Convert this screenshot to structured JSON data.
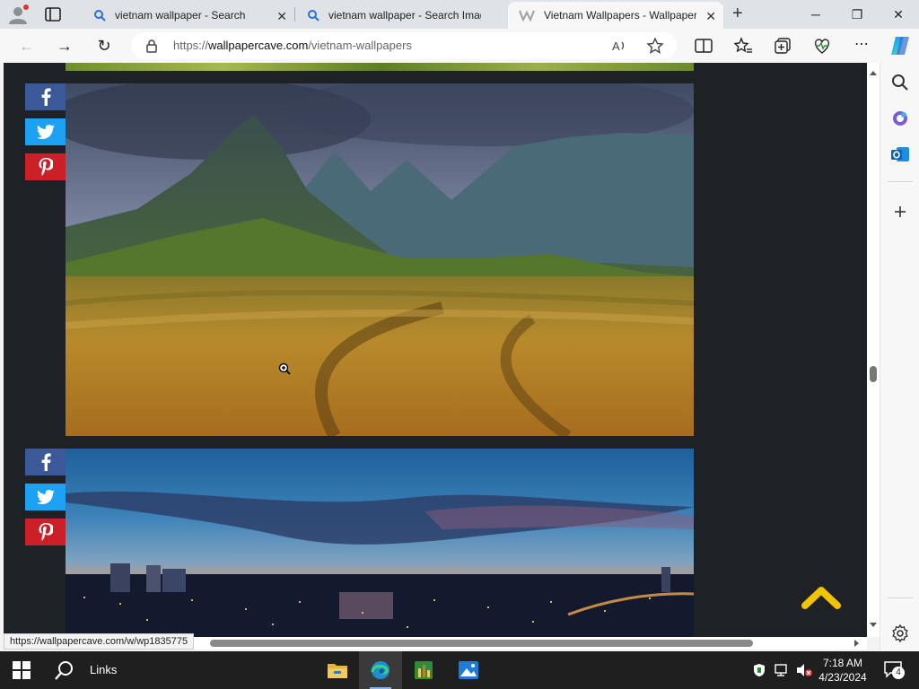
{
  "browser": {
    "tabs": [
      {
        "label": "vietnam wallpaper - Search",
        "active": false
      },
      {
        "label": "vietnam wallpaper - Search Imag",
        "active": false
      },
      {
        "label": "Vietnam Wallpapers - Wallpaper",
        "active": true
      }
    ],
    "address": {
      "prefix": "https://",
      "domain": "wallpapercave.com",
      "path": "/vietnam-wallpapers"
    },
    "status_url": "https://wallpapercave.com/w/wp1835775"
  },
  "page": {
    "images": [
      {
        "name": "rice-terraces-mountain-photo",
        "colors": {
          "sky": "#5f6c86",
          "field": "#b88a2c"
        }
      },
      {
        "name": "city-sunset-photo",
        "colors": {
          "sky": "#2f6fa6",
          "glow": "#e8945a"
        }
      }
    ],
    "share_icons": [
      "facebook-icon",
      "twitter-icon",
      "pinterest-icon"
    ],
    "accent": "#f2c300"
  },
  "taskbar": {
    "search_label": "Links",
    "time": "7:18 AM",
    "date": "4/23/2024",
    "notification_count": "4"
  }
}
